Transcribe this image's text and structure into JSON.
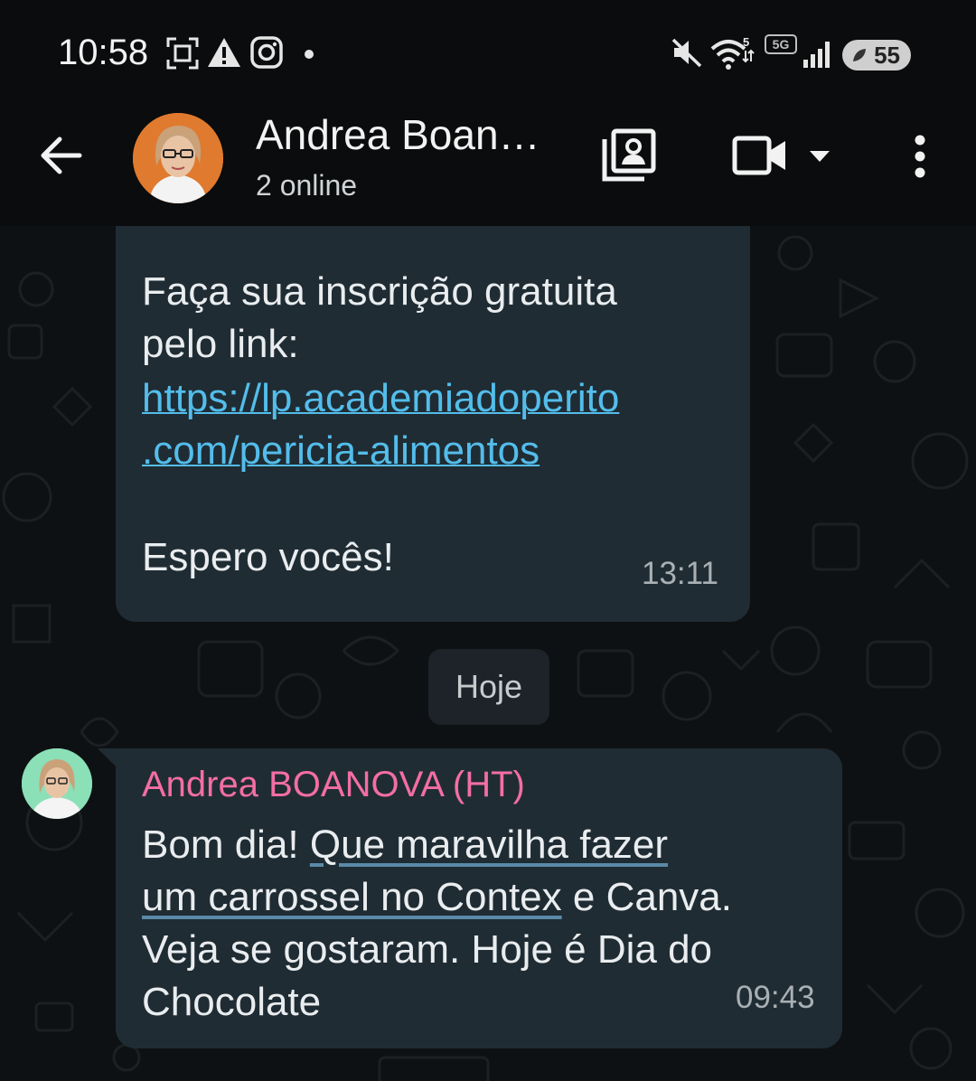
{
  "status_bar": {
    "time": "10:58",
    "battery": "55",
    "icons": [
      "screenshot-icon",
      "warning-icon",
      "instagram-icon",
      "dot-icon",
      "mute-icon",
      "wifi-icon",
      "5g-icon",
      "signal-icon",
      "battery-icon"
    ]
  },
  "header": {
    "title": "Andrea Boan…",
    "subtitle": "2 online",
    "icons": [
      "back-arrow-icon",
      "contacts-icon",
      "video-call-icon",
      "dropdown-icon",
      "more-vert-icon"
    ]
  },
  "messages": [
    {
      "text_1": "Faça sua inscrição gratuita\npelo link:",
      "link_1": "https://lp.academiadoperito",
      "link_2": ".com/pericia-alimentos",
      "text_2": "Espero vocês!",
      "time": "13:11"
    }
  ],
  "day_chip": "Hoje",
  "incoming": {
    "sender": "Andrea BOANOVA (HT)",
    "line_1_a": "Bom dia! ",
    "line_1_b": "Que maravilha fazer",
    "line_2_a": "um carrossel no Contex",
    "line_2_b": " e Canva.",
    "line_3": "Veja se gostaram. Hoje é Dia do",
    "line_4": "Chocolate",
    "time": "09:43"
  },
  "colors": {
    "bubble": "#202c33",
    "link": "#53bdeb",
    "sender": "#f36ea3",
    "background": "#0e1113"
  }
}
